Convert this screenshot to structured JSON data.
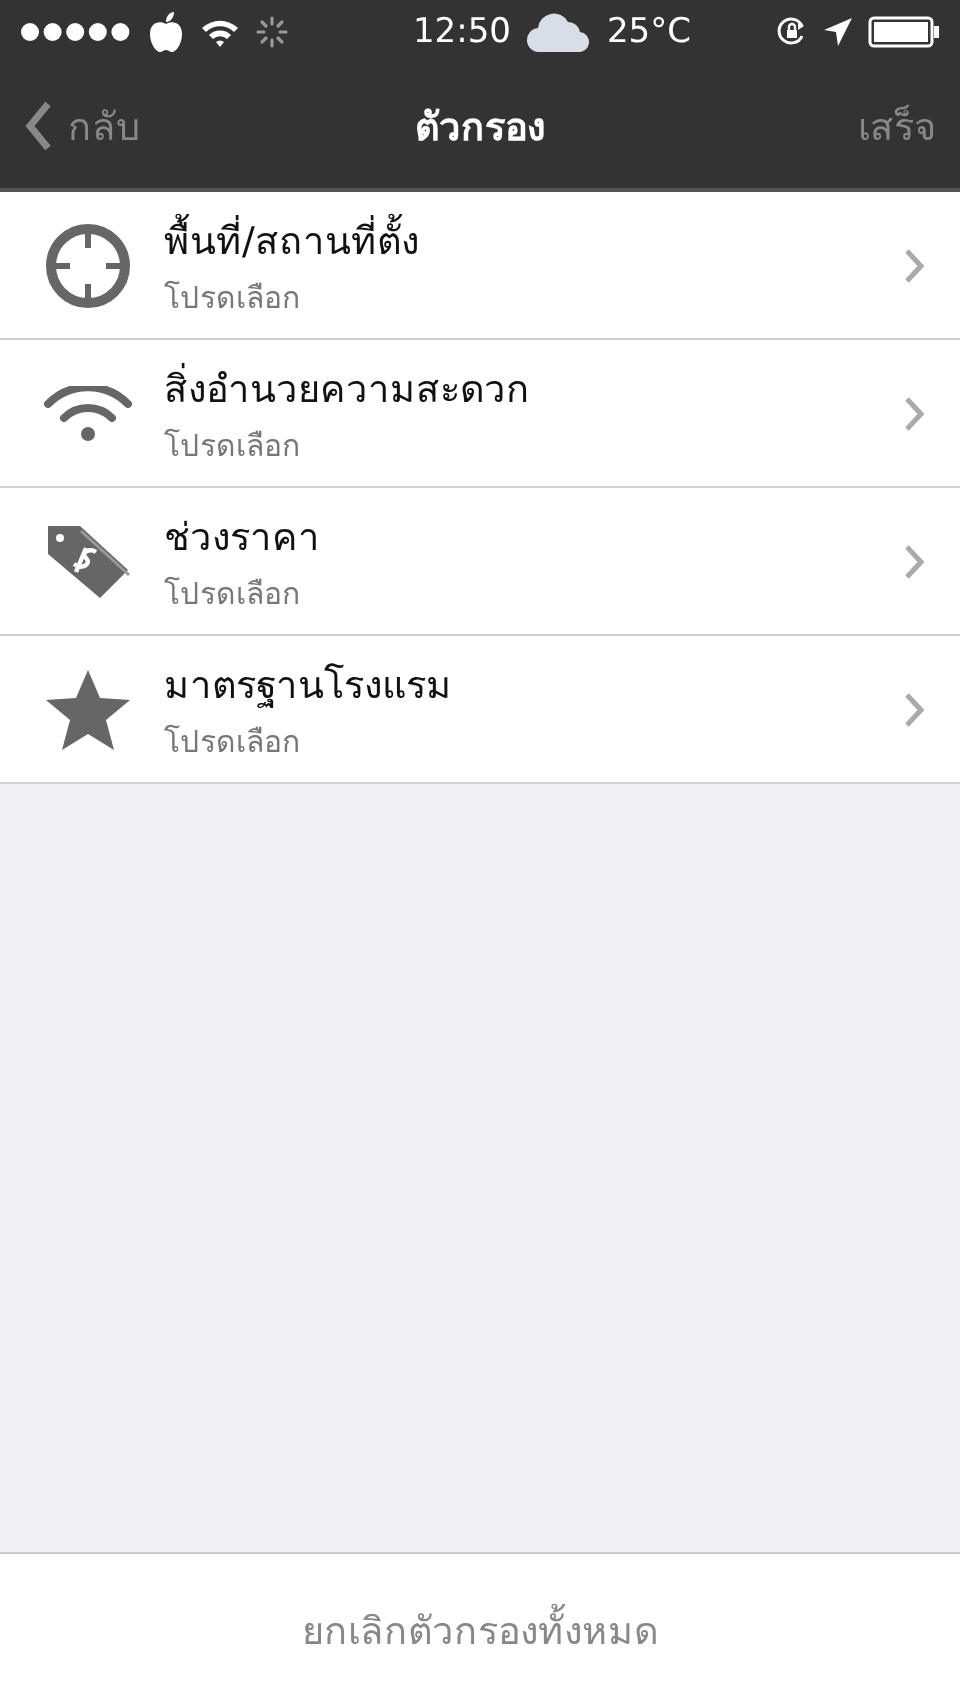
{
  "status_bar": {
    "time": "12:50",
    "temperature": "25°C"
  },
  "nav_bar": {
    "back": "กลับ",
    "title": "ตัวกรอง",
    "done": "เสร็จ"
  },
  "filters": [
    {
      "kind": "location",
      "title": "พื้นที่/สถานที่ตั้ง",
      "subtitle": "โปรดเลือก"
    },
    {
      "kind": "wifi",
      "title": "สิ่งอำนวยความสะดวก",
      "subtitle": "โปรดเลือก"
    },
    {
      "kind": "price",
      "title": "ช่วงราคา",
      "subtitle": "โปรดเลือก"
    },
    {
      "kind": "star",
      "title": "มาตรฐานโรงแรม",
      "subtitle": "โปรดเลือก"
    }
  ],
  "footer": {
    "button": "ยกเลิกตัวกรองทั้งหมด"
  }
}
